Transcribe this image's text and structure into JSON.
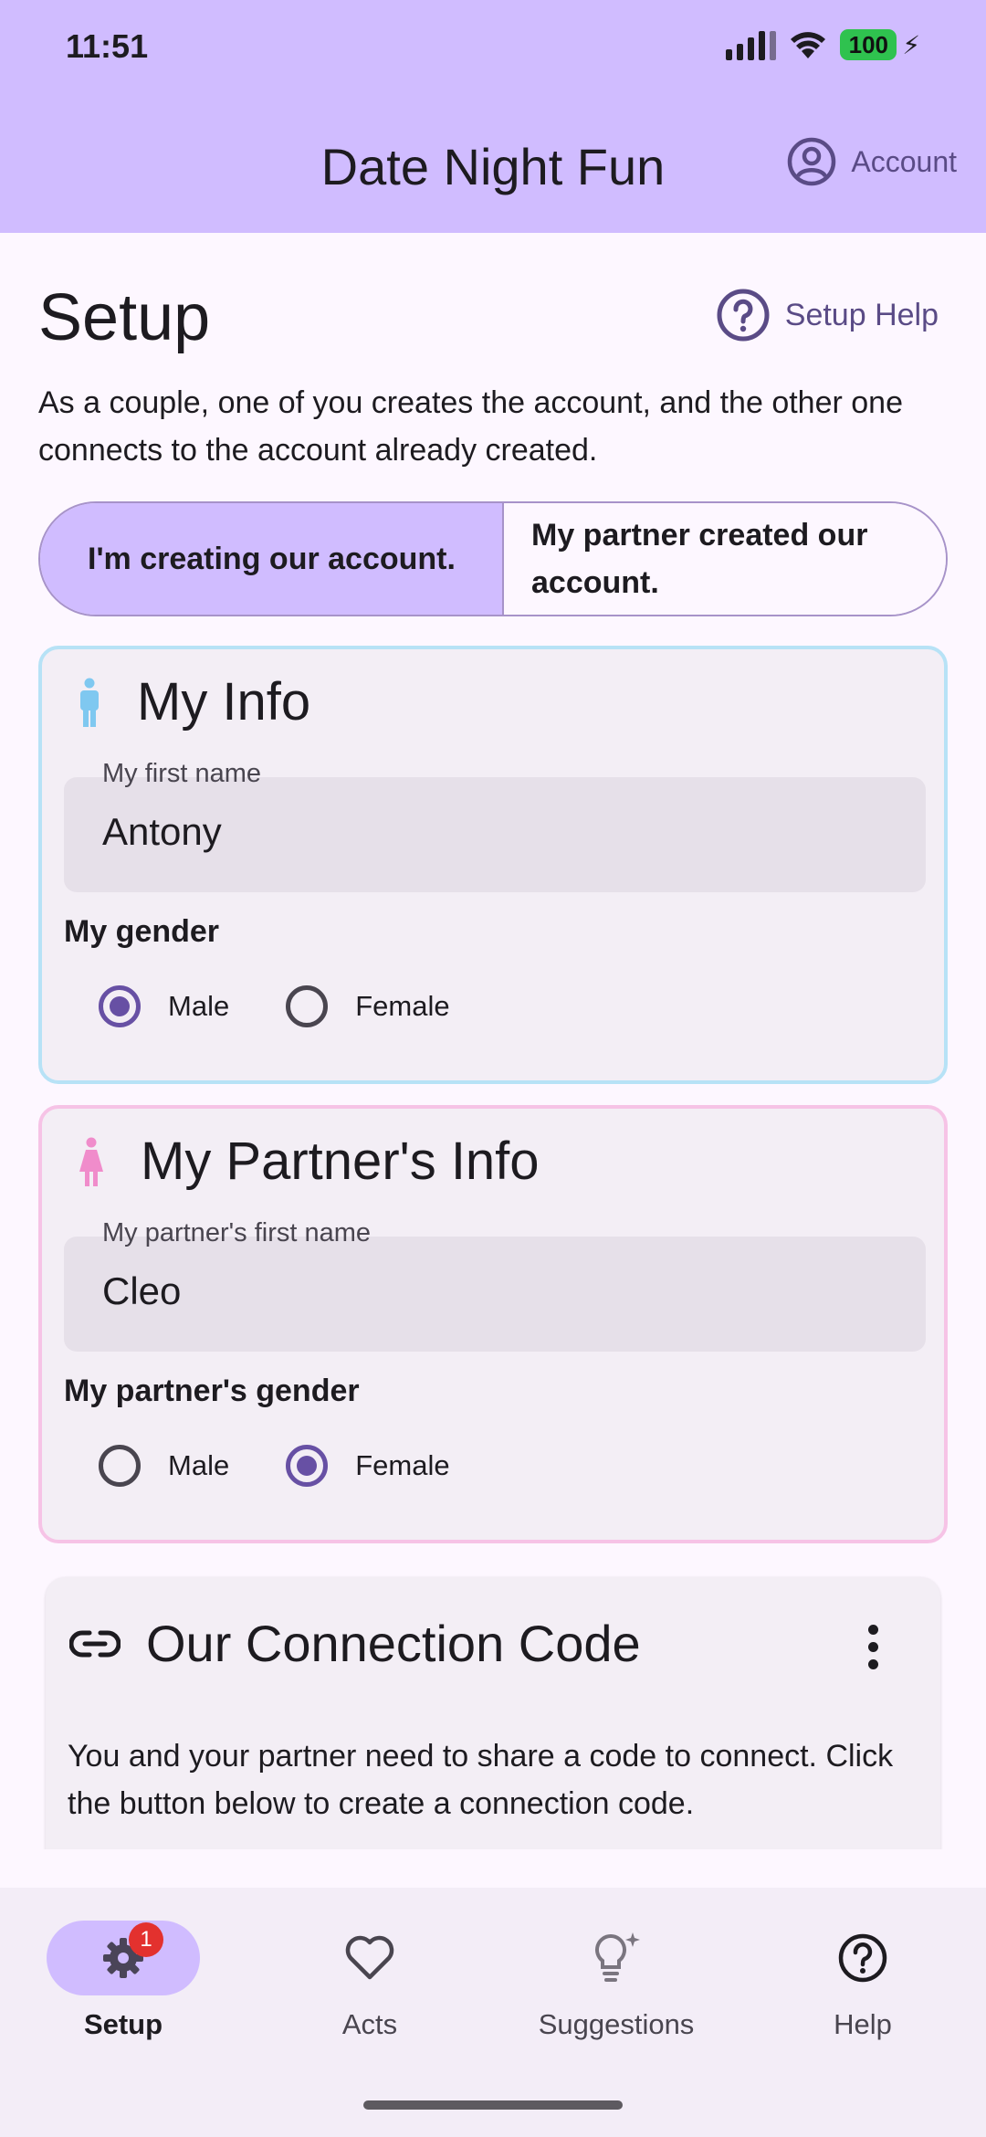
{
  "status_bar": {
    "time": "11:51",
    "battery": "100"
  },
  "app_bar": {
    "title": "Date Night Fun",
    "account_label": "Account"
  },
  "page": {
    "title": "Setup",
    "help_label": "Setup Help",
    "intro": "As a couple, one of you creates the account, and the other one connects to the account already created."
  },
  "segmented": {
    "option_creating": "I'm creating our account.",
    "option_partner": "My partner created our account.",
    "selected": "option_creating"
  },
  "my_info": {
    "title": "My Info",
    "name_label": "My first name",
    "name_value": "Antony",
    "gender_label": "My gender",
    "male_label": "Male",
    "female_label": "Female",
    "selected_gender": "Male"
  },
  "partner_info": {
    "title": "My Partner's Info",
    "name_label": "My partner's first name",
    "name_value": "Cleo",
    "gender_label": "My partner's gender",
    "male_label": "Male",
    "female_label": "Female",
    "selected_gender": "Female"
  },
  "connection": {
    "title": "Our Connection Code",
    "text": "You and your partner need to share a code to connect. Click the button below to create a connection code."
  },
  "bottom_nav": {
    "items": [
      {
        "label": "Setup",
        "icon": "gear-icon",
        "badge": "1",
        "active": true
      },
      {
        "label": "Acts",
        "icon": "heart-icon",
        "active": false
      },
      {
        "label": "Suggestions",
        "icon": "lightbulb-icon",
        "active": false
      },
      {
        "label": "Help",
        "icon": "help-icon",
        "active": false
      }
    ]
  },
  "colors": {
    "primary_container": "#d0bcff",
    "primary": "#6750a4",
    "my_info_border": "#b7e2f6",
    "partner_border": "#f6c3e6",
    "male_icon": "#7fc8f0",
    "female_icon": "#f08ccb",
    "badge": "#e3312e"
  }
}
